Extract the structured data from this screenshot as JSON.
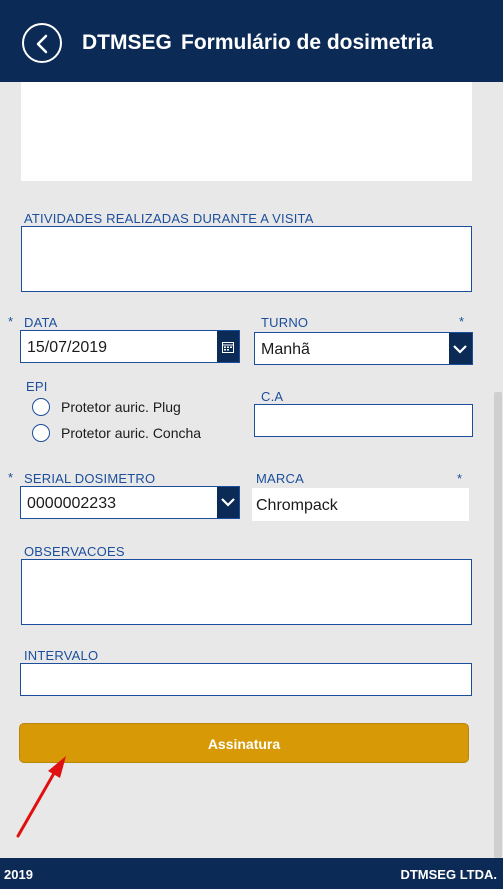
{
  "header": {
    "app_name": "DTMSEG",
    "title": "Formulário de dosimetria"
  },
  "form": {
    "atividades": {
      "label": "ATIVIDADES REALIZADAS DURANTE A VISITA",
      "value": ""
    },
    "data": {
      "label": "DATA",
      "required": "*",
      "value": "15/07/2019"
    },
    "turno": {
      "label": "TURNO",
      "required": "*",
      "value": "Manhã"
    },
    "epi": {
      "label": "EPI",
      "options": [
        "Protetor auric. Plug",
        "Protetor auric. Concha"
      ]
    },
    "ca": {
      "label": "C.A",
      "value": ""
    },
    "serial": {
      "label": "SERIAL DOSIMETRO",
      "required": "*",
      "value": "0000002233"
    },
    "marca": {
      "label": "MARCA",
      "required": "*",
      "value": "Chrompack"
    },
    "observacoes": {
      "label": "OBSERVACOES",
      "value": ""
    },
    "intervalo": {
      "label": "INTERVALO",
      "value": ""
    },
    "submit_label": "Assinatura"
  },
  "footer": {
    "year": "2019",
    "company": "DTMSEG LTDA."
  },
  "colors": {
    "primary": "#0b2a55",
    "accent": "#d79a06",
    "label": "#1c4e9c",
    "annotation_arrow": "#e01010"
  },
  "icons": [
    "back-arrow-icon",
    "calendar-icon",
    "chevron-down-icon"
  ]
}
